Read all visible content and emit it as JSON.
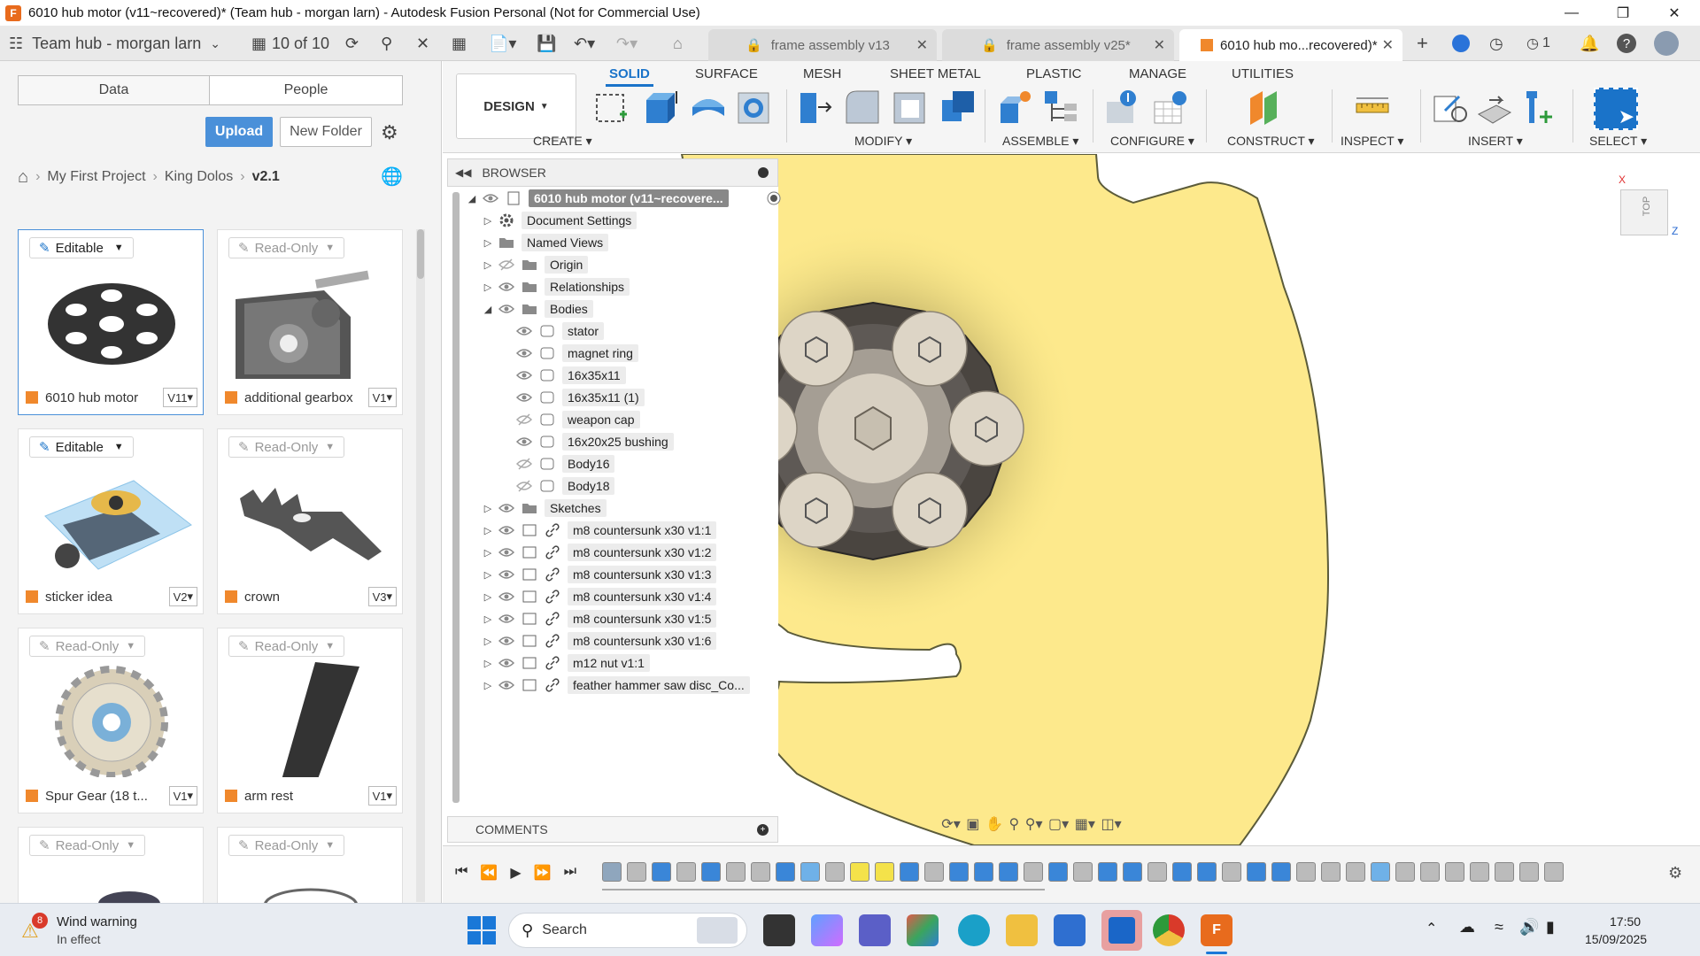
{
  "window": {
    "title": "6010 hub motor (v11~recovered)* (Team hub - morgan larn) - Autodesk Fusion Personal (Not for Commercial Use)",
    "app_icon_letter": "F"
  },
  "header": {
    "team": "Team hub - morgan larn",
    "doc_count": "10 of 10",
    "tabs": [
      {
        "label": "frame assembly v13"
      },
      {
        "label": "frame assembly v25*"
      },
      {
        "label": "6010 hub mo...recovered)*"
      }
    ],
    "job_count": "1"
  },
  "data_panel": {
    "segments": [
      "Data",
      "People"
    ],
    "upload_label": "Upload",
    "new_folder_label": "New Folder",
    "breadcrumb": [
      "My First Project",
      "King Dolos",
      "v2.1"
    ],
    "cards": [
      {
        "status": "Editable",
        "name": "6010 hub motor",
        "version": "V11"
      },
      {
        "status": "Read-Only",
        "name": "additional gearbox",
        "version": "V1"
      },
      {
        "status": "Editable",
        "name": "sticker idea",
        "version": "V2"
      },
      {
        "status": "Read-Only",
        "name": "crown",
        "version": "V3"
      },
      {
        "status": "Read-Only",
        "name": "Spur Gear (18 t...",
        "version": "V1"
      },
      {
        "status": "Read-Only",
        "name": "arm rest",
        "version": "V1"
      },
      {
        "status": "Read-Only",
        "name": "",
        "version": ""
      },
      {
        "status": "Read-Only",
        "name": "",
        "version": ""
      }
    ]
  },
  "ribbon": {
    "workspace": "DESIGN",
    "tabs": [
      "SOLID",
      "SURFACE",
      "MESH",
      "SHEET METAL",
      "PLASTIC",
      "MANAGE",
      "UTILITIES"
    ],
    "groups": [
      "CREATE",
      "MODIFY",
      "ASSEMBLE",
      "CONFIGURE",
      "CONSTRUCT",
      "INSPECT",
      "INSERT",
      "SELECT"
    ]
  },
  "browser": {
    "title": "BROWSER",
    "root": "6010 hub motor (v11~recovere...",
    "items": [
      {
        "label": "Document Settings"
      },
      {
        "label": "Named Views"
      },
      {
        "label": "Origin"
      },
      {
        "label": "Relationships"
      },
      {
        "label": "Bodies"
      },
      {
        "label": "stator"
      },
      {
        "label": "magnet ring"
      },
      {
        "label": "16x35x11"
      },
      {
        "label": "16x35x11 (1)"
      },
      {
        "label": "weapon cap"
      },
      {
        "label": "16x20x25 bushing"
      },
      {
        "label": "Body16"
      },
      {
        "label": "Body18"
      },
      {
        "label": "Sketches"
      },
      {
        "label": "m8 countersunk x30 v1:1"
      },
      {
        "label": "m8 countersunk x30 v1:2"
      },
      {
        "label": "m8 countersunk x30 v1:3"
      },
      {
        "label": "m8 countersunk x30 v1:4"
      },
      {
        "label": "m8 countersunk x30 v1:5"
      },
      {
        "label": "m8 countersunk x30 v1:6"
      },
      {
        "label": "m12 nut v1:1"
      },
      {
        "label": "feather hammer saw disc_Co..."
      }
    ],
    "comments": "COMMENTS"
  },
  "viewcube": {
    "face": "TOP",
    "axis_x": "X",
    "axis_z": "Z"
  },
  "taskbar": {
    "weather_title": "Wind warning",
    "weather_sub": "In effect",
    "weather_badge": "8",
    "search": "Search",
    "time": "17:50",
    "date": "15/09/2025"
  }
}
